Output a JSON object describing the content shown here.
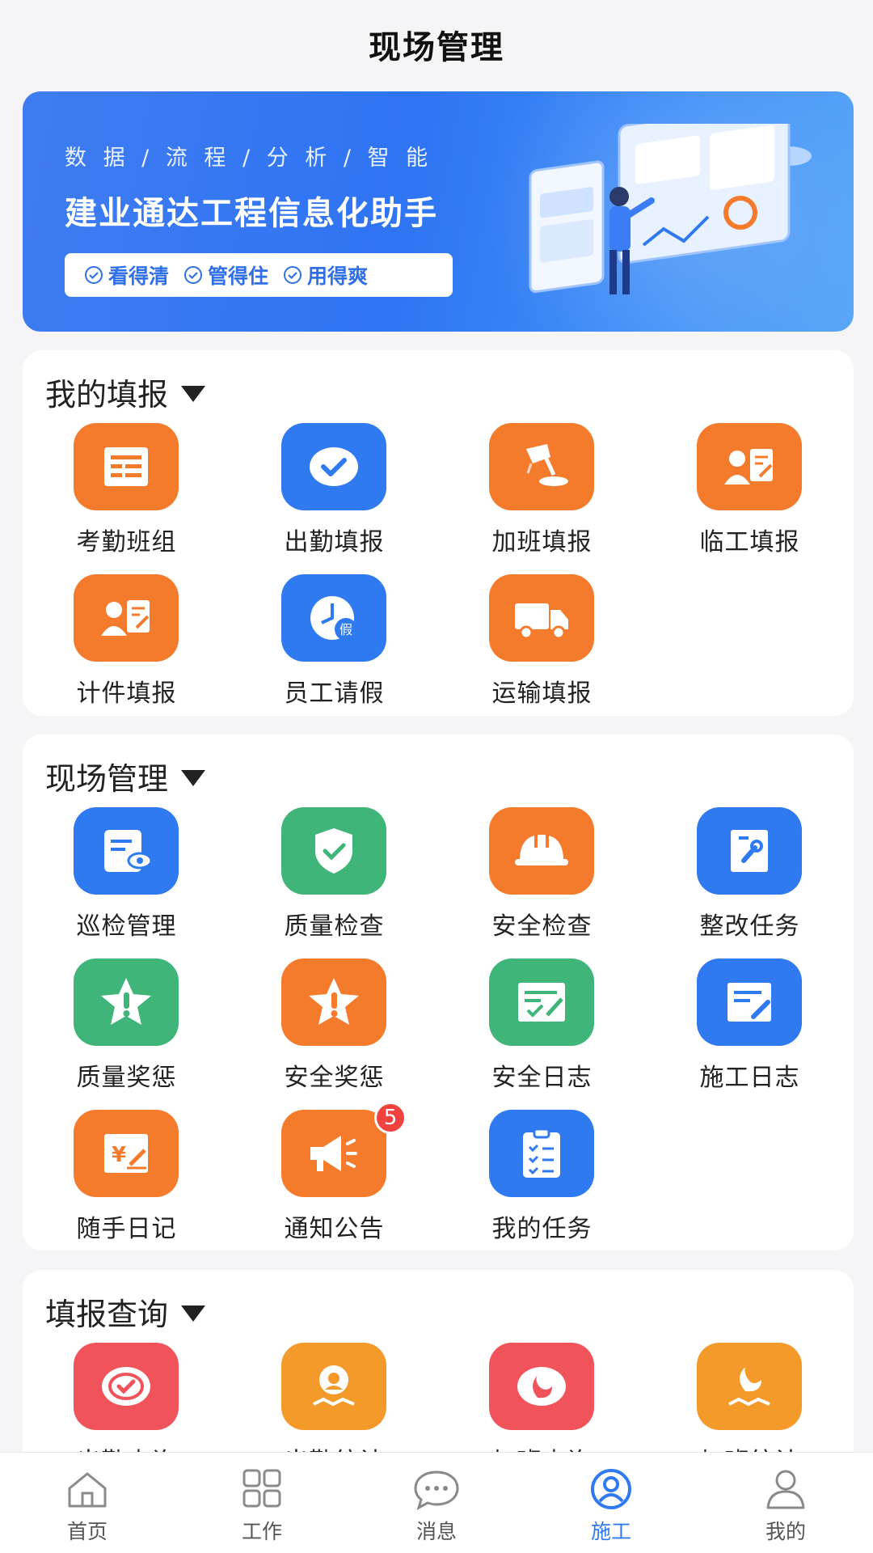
{
  "header": {
    "title": "现场管理"
  },
  "banner": {
    "tagline": "数 据 / 流 程 / 分 析 / 智 能",
    "title": "建业通达工程信息化助手",
    "pills": [
      "看得清",
      "管得住",
      "用得爽"
    ]
  },
  "sections": [
    {
      "title": "我的填报",
      "items": [
        {
          "label": "考勤班组",
          "icon": "list-icon",
          "color": "#f47b2c"
        },
        {
          "label": "出勤填报",
          "icon": "check-circle-icon",
          "color": "#2f7af1"
        },
        {
          "label": "加班填报",
          "icon": "desk-lamp-icon",
          "color": "#f47b2c"
        },
        {
          "label": "临工填报",
          "icon": "person-form-icon",
          "color": "#f47b2c"
        },
        {
          "label": "计件填报",
          "icon": "person-form-icon",
          "color": "#f47b2c"
        },
        {
          "label": "员工请假",
          "icon": "clock-leave-icon",
          "color": "#2f7af1"
        },
        {
          "label": "运输填报",
          "icon": "truck-icon",
          "color": "#f47b2c"
        }
      ]
    },
    {
      "title": "现场管理",
      "items": [
        {
          "label": "巡检管理",
          "icon": "inspect-doc-icon",
          "color": "#2f7af1"
        },
        {
          "label": "质量检查",
          "icon": "shield-check-icon",
          "color": "#3fb57a"
        },
        {
          "label": "安全检查",
          "icon": "helmet-icon",
          "color": "#f47b2c"
        },
        {
          "label": "整改任务",
          "icon": "wrench-doc-icon",
          "color": "#2f7af1"
        },
        {
          "label": "质量奖惩",
          "icon": "star-alert-icon",
          "color": "#3fb57a"
        },
        {
          "label": "安全奖惩",
          "icon": "star-alert-icon",
          "color": "#f47b2c"
        },
        {
          "label": "安全日志",
          "icon": "log-check-icon",
          "color": "#3fb57a"
        },
        {
          "label": "施工日志",
          "icon": "log-edit-icon",
          "color": "#2f7af1"
        },
        {
          "label": "随手日记",
          "icon": "yen-note-icon",
          "color": "#f47b2c"
        },
        {
          "label": "通知公告",
          "icon": "megaphone-icon",
          "color": "#f47b2c",
          "badge": "5"
        },
        {
          "label": "我的任务",
          "icon": "clipboard-list-icon",
          "color": "#2f7af1"
        }
      ]
    },
    {
      "title": "填报查询",
      "items": [
        {
          "label": "出勤查询",
          "icon": "check-query-icon",
          "color": "#f0545a"
        },
        {
          "label": "出勤统计",
          "icon": "person-stat-icon",
          "color": "#f39a2a"
        },
        {
          "label": "加班查询",
          "icon": "moon-query-icon",
          "color": "#f0545a"
        },
        {
          "label": "加班统计",
          "icon": "moon-stat-icon",
          "color": "#f39a2a"
        }
      ]
    }
  ],
  "tabbar": {
    "items": [
      {
        "label": "首页",
        "icon": "home-icon"
      },
      {
        "label": "工作",
        "icon": "grid-icon"
      },
      {
        "label": "消息",
        "icon": "chat-icon"
      },
      {
        "label": "施工",
        "icon": "user-circle-icon",
        "active": true
      },
      {
        "label": "我的",
        "icon": "person-icon"
      }
    ]
  }
}
